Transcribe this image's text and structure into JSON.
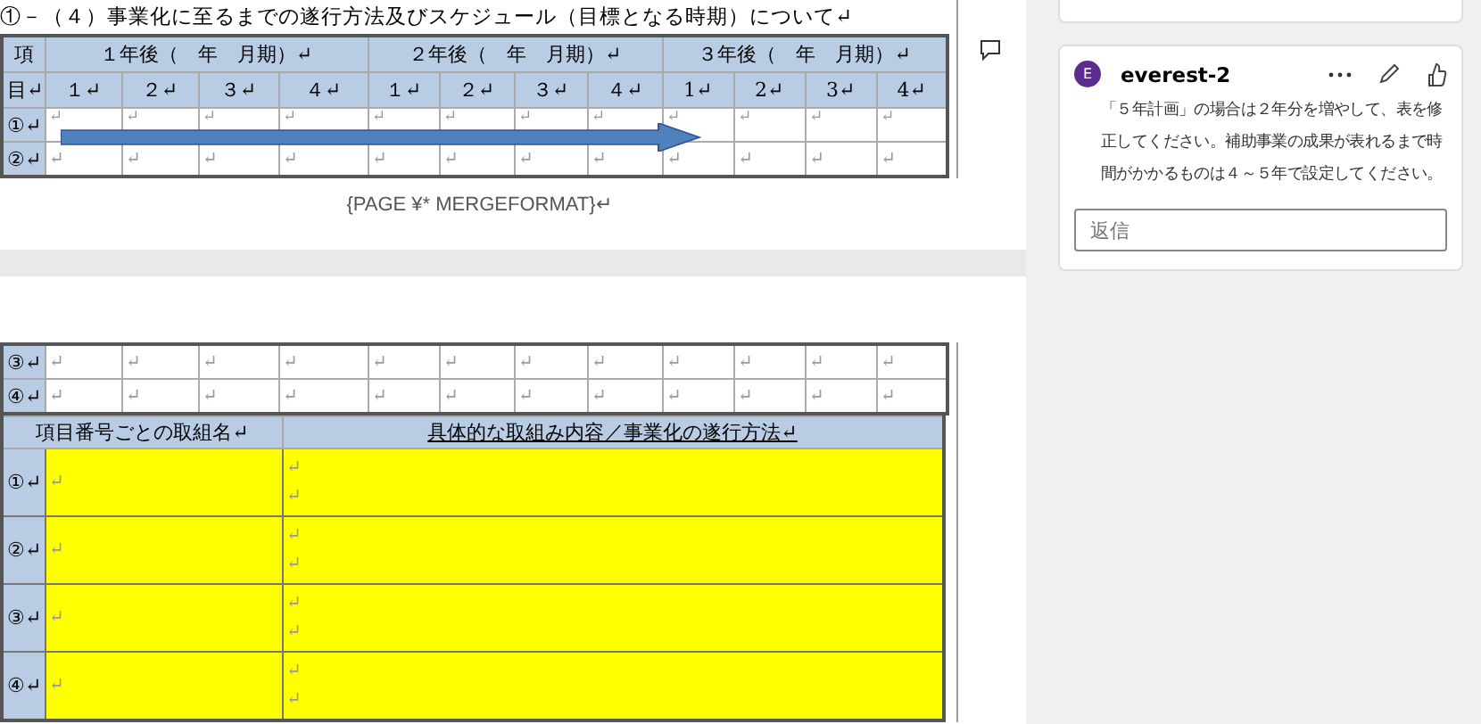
{
  "page_1": {
    "heading": "①－（４）事業化に至るまでの遂行方法及びスケジュール（目標となる時期）について↵",
    "schedule_table": {
      "corner_top": "項",
      "corner_bottom": "目↵",
      "years": [
        {
          "label": "１年後（　年　月期）↵",
          "quarters": [
            "１↵",
            "２↵",
            "３↵",
            "４↵"
          ]
        },
        {
          "label": "２年後（　年　月期）↵",
          "quarters": [
            "１↵",
            "２↵",
            "３↵",
            "４↵"
          ]
        },
        {
          "label": "３年後（　年　月期）↵",
          "quarters": [
            "1↵",
            "2↵",
            "3↵",
            "4↵"
          ]
        }
      ],
      "rows": [
        {
          "label": "①↵",
          "cells": [
            "↵",
            "↵",
            "↵",
            "↵",
            "↵",
            "↵",
            "↵",
            "↵",
            "↵",
            "↵",
            "↵",
            "↵"
          ]
        },
        {
          "label": "②↵",
          "cells": [
            "↵",
            "↵",
            "↵",
            "↵",
            "↵",
            "↵",
            "↵",
            "↵",
            "↵",
            "↵",
            "↵",
            "↵"
          ]
        }
      ]
    },
    "footer_field": "{PAGE    ¥* MERGEFORMAT}↵"
  },
  "page_2": {
    "schedule_rows": [
      {
        "label": "③↵",
        "cells": [
          "↵",
          "↵",
          "↵",
          "↵",
          "↵",
          "↵",
          "↵",
          "↵",
          "↵",
          "↵",
          "↵",
          "↵"
        ]
      },
      {
        "label": "④↵",
        "cells": [
          "↵",
          "↵",
          "↵",
          "↵",
          "↵",
          "↵",
          "↵",
          "↵",
          "↵",
          "↵",
          "↵",
          "↵"
        ]
      }
    ],
    "plan_table": {
      "name_heading": "項目番号ごとの取組名↵",
      "content_heading": "具体的な取組み内容／事業化の遂行方法↵",
      "rows": [
        {
          "label": "①↵",
          "name": "↵",
          "content": [
            "↵",
            "↵"
          ]
        },
        {
          "label": "②↵",
          "name": "↵",
          "content": [
            "↵",
            "↵"
          ]
        },
        {
          "label": "③↵",
          "name": "↵",
          "content": [
            "↵",
            "↵"
          ]
        },
        {
          "label": "④↵",
          "name": "↵",
          "content": [
            "↵",
            "↵"
          ]
        }
      ]
    }
  },
  "comment": {
    "avatar": "E",
    "author": "everest-2",
    "text": "「５年計画」の場合は２年分を増やして、表を修正してください。補助事業の成果が表れるまで時間がかかるものは４～５年で設定してください。",
    "reply_placeholder": "返信"
  }
}
